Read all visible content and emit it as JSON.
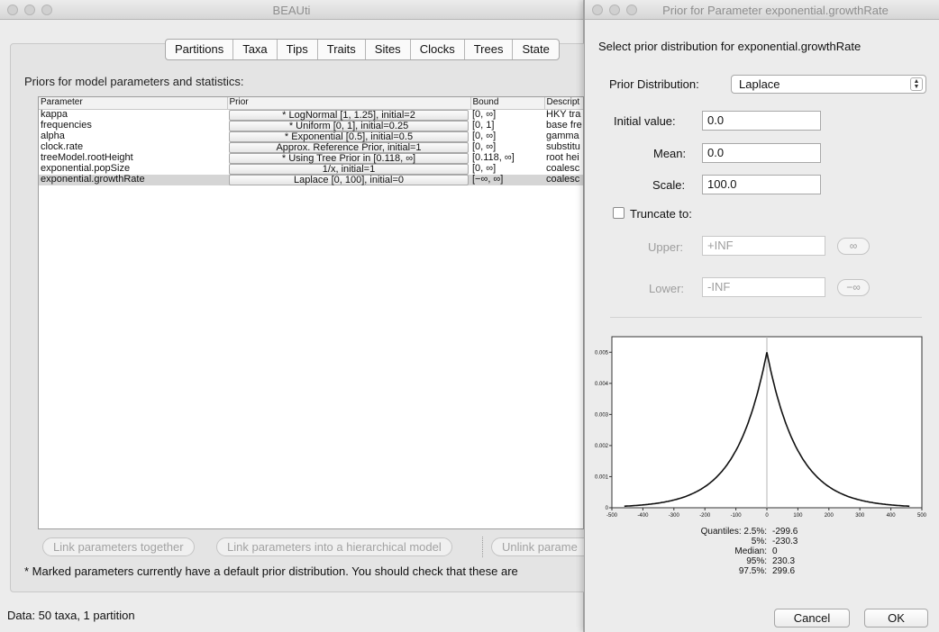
{
  "main": {
    "title": "BEAUti",
    "tabs": [
      "Partitions",
      "Taxa",
      "Tips",
      "Traits",
      "Sites",
      "Clocks",
      "Trees",
      "State"
    ],
    "section_label": "Priors for model parameters and statistics:",
    "table": {
      "headers": [
        "Parameter",
        "Prior",
        "Bound",
        "Descript"
      ],
      "rows": [
        {
          "param": "kappa",
          "prior": "* LogNormal [1, 1.25], initial=2",
          "bound": "[0, ∞]",
          "desc": "HKY tra"
        },
        {
          "param": "frequencies",
          "prior": "* Uniform [0, 1], initial=0.25",
          "bound": "[0, 1]",
          "desc": "base fre"
        },
        {
          "param": "alpha",
          "prior": "* Exponential [0.5], initial=0.5",
          "bound": "[0, ∞]",
          "desc": "gamma"
        },
        {
          "param": "clock.rate",
          "prior": "Approx. Reference Prior, initial=1",
          "bound": "[0, ∞]",
          "desc": "substitu"
        },
        {
          "param": "treeModel.rootHeight",
          "prior": "* Using Tree Prior in [0.118, ∞]",
          "bound": "[0.118, ∞]",
          "desc": "root hei"
        },
        {
          "param": "exponential.popSize",
          "prior": "1/x, initial=1",
          "bound": "[0, ∞]",
          "desc": "coalesc"
        },
        {
          "param": "exponential.growthRate",
          "prior": "Laplace [0, 100], initial=0",
          "bound": "[−∞, ∞]",
          "desc": "coalesc"
        }
      ]
    },
    "buttons": {
      "link": "Link parameters together",
      "hier": "Link parameters into a hierarchical model",
      "unlink": "Unlink parame"
    },
    "note": "* Marked parameters currently have a default prior distribution. You should check that these are",
    "status": "Data: 50 taxa, 1 partition"
  },
  "dialog": {
    "title": "Prior for Parameter exponential.growthRate",
    "heading": "Select prior distribution for exponential.growthRate",
    "dist_label": "Prior Distribution:",
    "dist_value": "Laplace",
    "initial_label": "Initial value:",
    "initial_value": "0.0",
    "mean_label": "Mean:",
    "mean_value": "0.0",
    "scale_label": "Scale:",
    "scale_value": "100.0",
    "truncate_label": "Truncate to:",
    "upper_label": "Upper:",
    "upper_value": "+INF",
    "upper_btn": "∞",
    "lower_label": "Lower:",
    "lower_value": "-INF",
    "lower_btn": "−∞",
    "quantiles": [
      {
        "k": "Quantiles: 2.5%:",
        "v": "-299.6"
      },
      {
        "k": "5%:",
        "v": "-230.3"
      },
      {
        "k": "Median:",
        "v": "0"
      },
      {
        "k": "95%:",
        "v": "230.3"
      },
      {
        "k": "97.5%:",
        "v": "299.6"
      }
    ],
    "cancel": "Cancel",
    "ok": "OK"
  },
  "chart_data": {
    "type": "line",
    "title": "",
    "xlabel": "",
    "ylabel": "",
    "xlim": [
      -500,
      500
    ],
    "ylim": [
      0,
      0.0055
    ],
    "x_ticks": [
      "-500",
      "-400",
      "-300",
      "-200",
      "-100",
      "0",
      "100",
      "200",
      "300",
      "400",
      "500"
    ],
    "y_ticks": [
      "0",
      "0.001",
      "0.002",
      "0.003",
      "0.004",
      "0.005"
    ],
    "series": [
      {
        "mean": 0,
        "scale": 100,
        "x_range": [
          -460,
          460
        ],
        "peak": 0.005
      }
    ],
    "grid": false
  }
}
